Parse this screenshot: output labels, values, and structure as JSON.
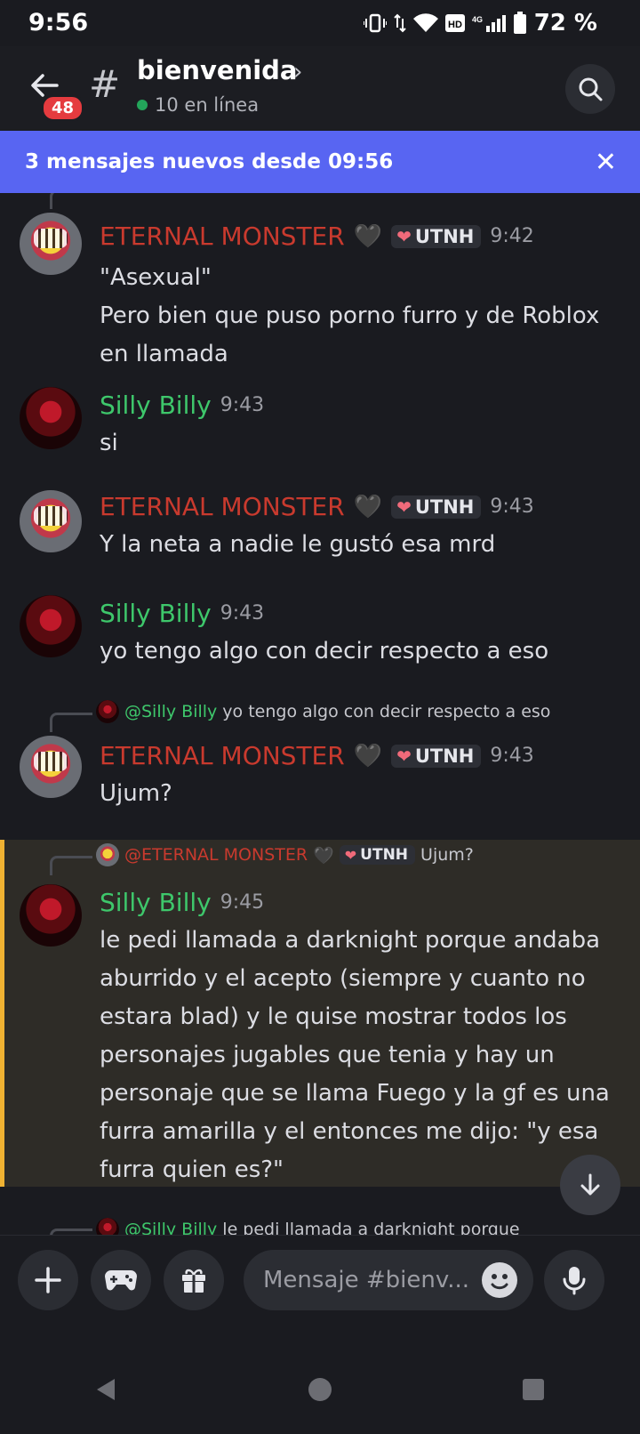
{
  "status": {
    "time": "9:56",
    "battery_pct": "72 %",
    "network": "4G"
  },
  "header": {
    "unread": "48",
    "channel": "bienvenida",
    "online": "10 en línea"
  },
  "banner": {
    "text": "3 mensajes nuevos desde 09:56"
  },
  "messages": [
    {
      "author": "ETERNAL MONSTER",
      "role": "UTNH",
      "time": "9:42",
      "lines": [
        "\"Asexual\"",
        "Pero bien que puso porno furro y de Roblox",
        "en llamada"
      ]
    },
    {
      "author": "Silly Billy",
      "time": "9:43",
      "lines": [
        "si"
      ]
    },
    {
      "author": "ETERNAL MONSTER",
      "role": "UTNH",
      "time": "9:43",
      "lines": [
        "Y la neta a nadie le gustó esa mrd"
      ]
    },
    {
      "author": "Silly Billy",
      "time": "9:43",
      "lines": [
        "yo tengo algo con decir respecto a eso"
      ]
    },
    {
      "reply_to": "@Silly Billy",
      "reply_text": "yo tengo algo con decir respecto a eso",
      "author": "ETERNAL MONSTER",
      "role": "UTNH",
      "time": "9:43",
      "lines": [
        "Ujum?"
      ]
    },
    {
      "reply_to": "@ETERNAL MONSTER",
      "reply_role": "UTNH",
      "reply_text": "Ujum?",
      "author": "Silly Billy",
      "time": "9:45",
      "lines": [
        "le pedi llamada a darknight porque andaba",
        "aburrido y el acepto (siempre y cuanto no",
        "estara blad) y le quise mostrar todos los",
        "personajes jugables que tenia y hay un",
        "personaje que se llama Fuego y la gf es una",
        "furra amarilla y el entonces me dijo: \"y esa",
        "furra quien es?\""
      ]
    },
    {
      "reply_to": "@Silly Billy",
      "reply_text": "le pedi llamada a darknight porque"
    }
  ],
  "composer": {
    "placeholder": "Mensaje #bienv..."
  },
  "colors": {
    "accent": "#5865f2",
    "eternal": "#c93a2e",
    "silly": "#3ec76b",
    "highlight": "#f0b232"
  }
}
